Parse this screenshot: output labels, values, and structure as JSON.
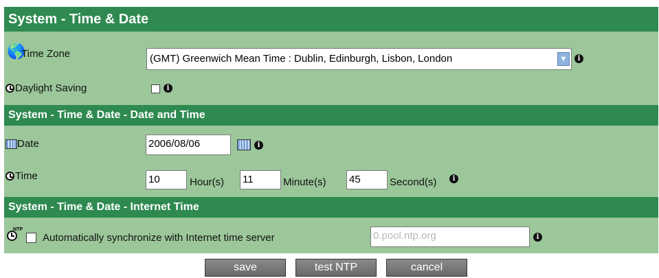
{
  "header": {
    "title": "System - Time & Date"
  },
  "timezone": {
    "label": "Time Zone",
    "selected": "(GMT) Greenwich Mean Time : Dublin, Edinburgh, Lisbon, London"
  },
  "daylight": {
    "label": "Daylight Saving",
    "checked": false
  },
  "section_date_time": {
    "title": "System - Time & Date - Date and Time"
  },
  "date": {
    "label": "Date",
    "value": "2006/08/06"
  },
  "time": {
    "label": "Time",
    "hour_value": "10",
    "hour_label": "Hour(s)",
    "minute_value": "11",
    "minute_label": "Minute(s)",
    "second_value": "45",
    "second_label": "Second(s)"
  },
  "section_internet": {
    "title": "System - Time & Date - Internet Time"
  },
  "ntp": {
    "label": "Automatically synchronize with Internet time server",
    "server_placeholder": "0.pool.ntp.org",
    "checked": false,
    "icon_text": "NTP"
  },
  "buttons": {
    "save": "save",
    "test": "test NTP",
    "cancel": "cancel"
  },
  "info_glyph": "i",
  "colors": {
    "header": "#2e8a50",
    "row": "#9cc79a",
    "button": "#777777"
  }
}
